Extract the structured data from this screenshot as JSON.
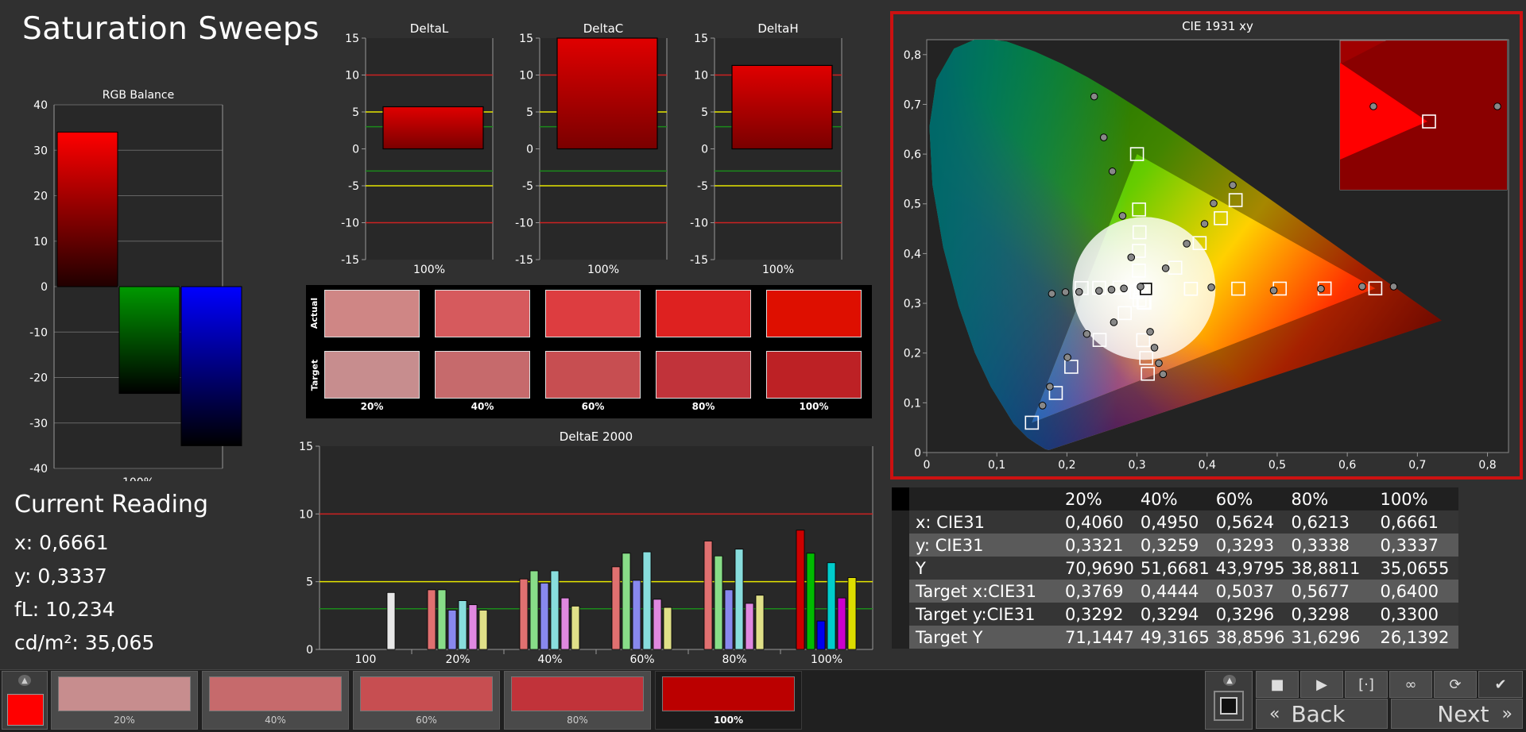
{
  "page_title": "Saturation Sweeps",
  "colors": {
    "red": "#ff0000",
    "green": "#009900",
    "blue": "#0000ff",
    "yellow": "#e6e600",
    "highlight": "#cc1111"
  },
  "current_reading": {
    "title": "Current Reading",
    "x": "x: 0,6661",
    "y": "y: 0,3337",
    "fl": "fL: 10,234",
    "cdm2": "cd/m²: 35,065"
  },
  "swatches": {
    "actual_label": "Actual",
    "target_label": "Target",
    "labels": [
      "20%",
      "40%",
      "60%",
      "80%",
      "100%"
    ],
    "actual_colors": [
      "#cf8685",
      "#d65a5d",
      "#dd3d40",
      "#de2120",
      "#de0f00"
    ],
    "target_colors": [
      "#c78d8e",
      "#c66a6c",
      "#c74e51",
      "#c1333a",
      "#bd2125"
    ]
  },
  "table": {
    "headers": [
      "",
      "20%",
      "40%",
      "60%",
      "80%",
      "100%"
    ],
    "rows": [
      [
        "x: CIE31",
        "0,4060",
        "0,4950",
        "0,5624",
        "0,6213",
        "0,6661"
      ],
      [
        "y: CIE31",
        "0,3321",
        "0,3259",
        "0,3293",
        "0,3338",
        "0,3337"
      ],
      [
        "Y",
        "70,9690",
        "51,6681",
        "43,9795",
        "38,8811",
        "35,0655"
      ],
      [
        "Target x:CIE31",
        "0,3769",
        "0,4444",
        "0,5037",
        "0,5677",
        "0,6400"
      ],
      [
        "Target y:CIE31",
        "0,3292",
        "0,3294",
        "0,3296",
        "0,3298",
        "0,3300"
      ],
      [
        "Target Y",
        "71,1447",
        "49,3165",
        "38,8596",
        "31,6296",
        "26,1392"
      ]
    ]
  },
  "bottom": {
    "thumbs": [
      "20%",
      "40%",
      "60%",
      "80%",
      "100%"
    ],
    "thumb_colors": [
      "#c78d8e",
      "#c66a6c",
      "#c74e51",
      "#c1333a",
      "#bb0000"
    ],
    "back_label": "Back",
    "next_label": "Next"
  },
  "chart_data": [
    {
      "id": "rgb-balance",
      "type": "bar",
      "title": "RGB Balance",
      "categories": [
        "100%"
      ],
      "series": [
        {
          "values": [
            34
          ]
        },
        {
          "values": [
            -23.5
          ]
        },
        {
          "values": [
            -35
          ]
        }
      ],
      "ylim": [
        -40,
        40
      ],
      "ticks": [
        40,
        30,
        20,
        10,
        0,
        -10,
        -20,
        -30,
        -40
      ],
      "grid": true
    },
    {
      "id": "delta-l",
      "type": "bar",
      "title": "DeltaL",
      "categories": [
        "100%"
      ],
      "values": [
        5.7
      ],
      "ylim": [
        -15,
        15
      ],
      "ticks": [
        15,
        10,
        5,
        0,
        -5,
        -10,
        -15
      ]
    },
    {
      "id": "delta-c",
      "type": "bar",
      "title": "DeltaC",
      "categories": [
        "100%"
      ],
      "values": [
        15
      ],
      "ylim": [
        -15,
        15
      ],
      "ticks": [
        15,
        10,
        5,
        0,
        -5,
        -10,
        -15
      ]
    },
    {
      "id": "delta-h",
      "type": "bar",
      "title": "DeltaH",
      "categories": [
        "100%"
      ],
      "values": [
        11.3
      ],
      "ylim": [
        -15,
        15
      ],
      "ticks": [
        15,
        10,
        5,
        0,
        -5,
        -10,
        -15
      ]
    },
    {
      "id": "delta-e",
      "type": "bar",
      "title": "DeltaE 2000",
      "categories": [
        "100",
        "20%",
        "40%",
        "60%",
        "80%",
        "100%"
      ],
      "series": [
        {
          "values": [
            0,
            4.4,
            5.2,
            6.1,
            8.0,
            8.8
          ]
        },
        {
          "values": [
            0,
            4.4,
            5.8,
            7.1,
            6.9,
            7.1
          ]
        },
        {
          "values": [
            0,
            2.9,
            4.9,
            5.1,
            4.4,
            2.1
          ]
        },
        {
          "values": [
            0,
            3.6,
            5.8,
            7.2,
            7.4,
            6.4
          ]
        },
        {
          "values": [
            0,
            3.3,
            3.8,
            3.7,
            3.4,
            3.8
          ]
        },
        {
          "values": [
            4.2,
            2.9,
            3.2,
            3.1,
            4.0,
            5.3
          ]
        }
      ],
      "series_colors": [
        "#e07070",
        "#88dd88",
        "#8888ee",
        "#88dddd",
        "#e088e0",
        "#e0e088"
      ],
      "single_color": "#e8e8e8",
      "ylim": [
        0,
        15
      ],
      "ticks": [
        15,
        10,
        5,
        0
      ]
    },
    {
      "id": "cie",
      "type": "scatter",
      "title": "CIE 1931 xy",
      "xlim": [
        0,
        0.83
      ],
      "ylim": [
        0,
        0.83
      ],
      "xticks": [
        "0",
        "0,1",
        "0,2",
        "0,3",
        "0,4",
        "0,5",
        "0,6",
        "0,7",
        "0,8"
      ],
      "yticks": [
        "0",
        "0,1",
        "0,2",
        "0,3",
        "0,4",
        "0,5",
        "0,6",
        "0,7",
        "0,8"
      ],
      "gamut": [
        [
          0.64,
          0.33
        ],
        [
          0.3,
          0.6
        ],
        [
          0.15,
          0.06
        ]
      ],
      "white": [
        0.3127,
        0.329
      ],
      "targets": [
        [
          0.3769,
          0.3292
        ],
        [
          0.4444,
          0.3294
        ],
        [
          0.5037,
          0.3296
        ],
        [
          0.5677,
          0.3298
        ],
        [
          0.64,
          0.33
        ],
        [
          0.3027,
          0.3657
        ],
        [
          0.3027,
          0.4055
        ],
        [
          0.3036,
          0.4428
        ],
        [
          0.3029,
          0.4886
        ],
        [
          0.3,
          0.6
        ],
        [
          0.275,
          0.3316
        ],
        [
          0.246,
          0.3311
        ],
        [
          0.221,
          0.3307
        ],
        [
          0.3054,
          0.326
        ],
        [
          0.3036,
          0.3067
        ],
        [
          0.3091,
          0.3026
        ],
        [
          0.3106,
          0.3012
        ],
        [
          0.2825,
          0.2804
        ],
        [
          0.2466,
          0.2264
        ],
        [
          0.2062,
          0.1724
        ],
        [
          0.1842,
          0.1197
        ],
        [
          0.15,
          0.06
        ],
        [
          0.3088,
          0.226
        ],
        [
          0.3132,
          0.1901
        ],
        [
          0.3154,
          0.1584
        ],
        [
          0.3546,
          0.3716
        ],
        [
          0.3893,
          0.4211
        ],
        [
          0.4195,
          0.4711
        ],
        [
          0.4407,
          0.5075
        ],
        [
          0.2993,
          0.3231
        ]
      ],
      "measured": [
        [
          0.406,
          0.3321
        ],
        [
          0.495,
          0.3259
        ],
        [
          0.5624,
          0.3293
        ],
        [
          0.6213,
          0.3338
        ],
        [
          0.6661,
          0.3337
        ],
        [
          0.2389,
          0.7158
        ],
        [
          0.2526,
          0.6336
        ],
        [
          0.2649,
          0.5653
        ],
        [
          0.2794,
          0.4758
        ],
        [
          0.2917,
          0.3924
        ],
        [
          0.305,
          0.3336
        ],
        [
          0.2813,
          0.3299
        ],
        [
          0.2636,
          0.3275
        ],
        [
          0.2459,
          0.3251
        ],
        [
          0.2174,
          0.3229
        ],
        [
          0.1979,
          0.3225
        ],
        [
          0.1785,
          0.3193
        ],
        [
          0.1652,
          0.0944
        ],
        [
          0.1756,
          0.1324
        ],
        [
          0.2008,
          0.1913
        ],
        [
          0.2284,
          0.2384
        ],
        [
          0.2669,
          0.2618
        ],
        [
          0.3187,
          0.2428
        ],
        [
          0.3249,
          0.2108
        ],
        [
          0.3311,
          0.1797
        ],
        [
          0.3372,
          0.1575
        ],
        [
          0.3409,
          0.3705
        ],
        [
          0.3709,
          0.4199
        ],
        [
          0.3963,
          0.4599
        ],
        [
          0.4093,
          0.5009
        ],
        [
          0.4366,
          0.5376
        ]
      ],
      "inset_points": [
        [
          0.6213,
          0.3338
        ],
        [
          0.6661,
          0.3337
        ]
      ]
    }
  ]
}
